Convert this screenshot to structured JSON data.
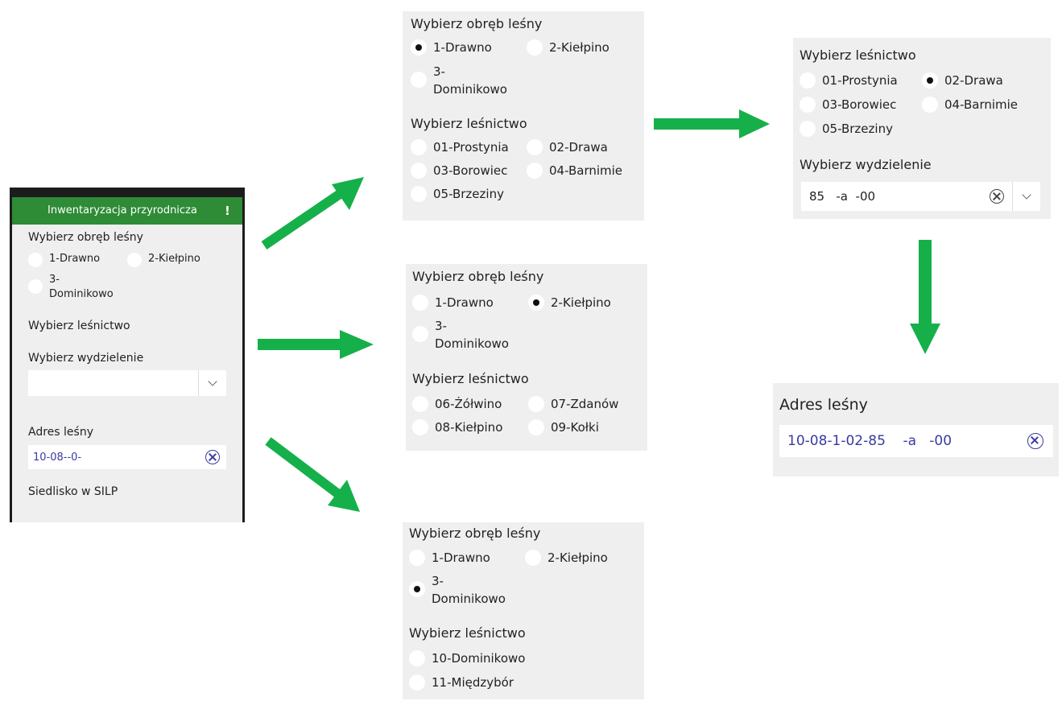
{
  "colors": {
    "header_green": "#2e8b36",
    "arrow_green": "#16b04a",
    "panel_bg": "#efefef",
    "link_blue": "#3a3aa0"
  },
  "phone": {
    "header_title": "Inwentaryzacja przyrodnicza",
    "obreb_title": "Wybierz obręb leśny",
    "obreb_options": [
      {
        "label": "1-Drawno",
        "selected": false
      },
      {
        "label": "2-Kiełpino",
        "selected": false
      },
      {
        "label": "3-\nDominikowo",
        "selected": false
      }
    ],
    "lesnictwo_title": "Wybierz leśnictwo",
    "wydzielenie_title": "Wybierz wydzielenie",
    "wydzielenie_value": "",
    "adres_title": "Adres leśny",
    "adres_value": "10-08--0-",
    "siedlisko_title": "Siedlisko w SILP"
  },
  "panel_drawno": {
    "obreb_title": "Wybierz obręb leśny",
    "obreb_options": [
      {
        "label": "1-Drawno",
        "selected": true
      },
      {
        "label": "2-Kiełpino",
        "selected": false
      },
      {
        "label": "3-\nDominikowo",
        "selected": false
      }
    ],
    "lesnictwo_title": "Wybierz leśnictwo",
    "lesnictwo_options": [
      {
        "label": "01-Prostynia",
        "selected": false
      },
      {
        "label": "02-Drawa",
        "selected": false
      },
      {
        "label": "03-Borowiec",
        "selected": false
      },
      {
        "label": "04-Barnimie",
        "selected": false
      },
      {
        "label": "05-Brzeziny",
        "selected": false
      }
    ]
  },
  "panel_kielpino": {
    "obreb_title": "Wybierz obręb leśny",
    "obreb_options": [
      {
        "label": "1-Drawno",
        "selected": false
      },
      {
        "label": "2-Kiełpino",
        "selected": true
      },
      {
        "label": "3-\nDominikowo",
        "selected": false
      }
    ],
    "lesnictwo_title": "Wybierz leśnictwo",
    "lesnictwo_options": [
      {
        "label": "06-Żółwino",
        "selected": false
      },
      {
        "label": "07-Zdanów",
        "selected": false
      },
      {
        "label": "08-Kiełpino",
        "selected": false
      },
      {
        "label": "09-Kołki",
        "selected": false
      }
    ]
  },
  "panel_dominikowo": {
    "obreb_title": "Wybierz obręb leśny",
    "obreb_options": [
      {
        "label": "1-Drawno",
        "selected": false
      },
      {
        "label": "2-Kiełpino",
        "selected": false
      },
      {
        "label": "3-\nDominikowo",
        "selected": true
      }
    ],
    "lesnictwo_title": "Wybierz leśnictwo",
    "lesnictwo_options": [
      {
        "label": "10-Dominikowo",
        "selected": false
      },
      {
        "label": "11-Międzybór",
        "selected": false
      }
    ]
  },
  "panel_lesnictwo": {
    "lesnictwo_title": "Wybierz leśnictwo",
    "lesnictwo_options": [
      {
        "label": "01-Prostynia",
        "selected": false
      },
      {
        "label": "02-Drawa",
        "selected": true
      },
      {
        "label": "03-Borowiec",
        "selected": false
      },
      {
        "label": "04-Barnimie",
        "selected": false
      },
      {
        "label": "05-Brzeziny",
        "selected": false
      }
    ],
    "wydzielenie_title": "Wybierz wydzielenie",
    "wydzielenie_value": "85   -a  -00"
  },
  "panel_adres": {
    "adres_title": "Adres leśny",
    "adres_value": "10-08-1-02-85    -a   -00"
  }
}
